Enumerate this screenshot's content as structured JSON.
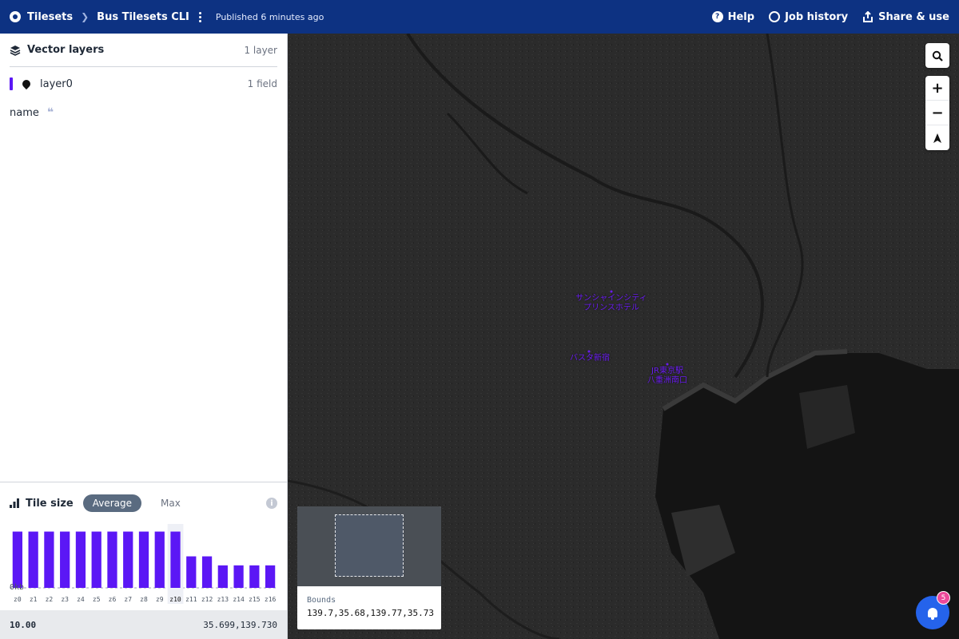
{
  "topbar": {
    "root_label": "Tilesets",
    "tileset_name": "Bus Tilesets CLI",
    "published": "Published 6 minutes ago",
    "help": "Help",
    "job_history": "Job history",
    "share": "Share & use"
  },
  "sidebar": {
    "title": "Vector layers",
    "layer_count": "1 layer",
    "layers": [
      {
        "name": "layer0",
        "field_count": "1 field",
        "color": "#5b17f5"
      }
    ],
    "fields": [
      {
        "name": "name",
        "type_icon": "quote-icon"
      }
    ]
  },
  "tile_size": {
    "title": "Tile size",
    "tab_average": "Average",
    "tab_max": "Max",
    "y_min_label": "0kb",
    "bar_color": "#5b17f5",
    "highlight_zoom": "z10"
  },
  "chart_data": {
    "type": "bar",
    "categories": [
      "z0",
      "z1",
      "z2",
      "z3",
      "z4",
      "z5",
      "z6",
      "z7",
      "z8",
      "z9",
      "z10",
      "z11",
      "z12",
      "z13",
      "z14",
      "z15",
      "z16"
    ],
    "values": [
      100,
      100,
      100,
      100,
      100,
      100,
      100,
      100,
      100,
      100,
      100,
      56,
      56,
      40,
      40,
      40,
      40
    ],
    "title": "Tile size",
    "ylabel": "",
    "ylim": [
      0,
      105
    ]
  },
  "status": {
    "zoom": "10.00",
    "coords": "35.699,139.730"
  },
  "map": {
    "labels": [
      {
        "lines": [
          "サンシャインシティ",
          "プリンスホテル"
        ]
      },
      {
        "lines": [
          "バスタ新宿"
        ]
      },
      {
        "lines": [
          "JR東京駅",
          "八重洲南口"
        ]
      }
    ],
    "label_color": "#6a1cf0"
  },
  "minimap": {
    "bounds_label": "Bounds",
    "bounds_value": "139.7,35.68,139.77,35.73"
  },
  "notifications": {
    "count": "5"
  }
}
